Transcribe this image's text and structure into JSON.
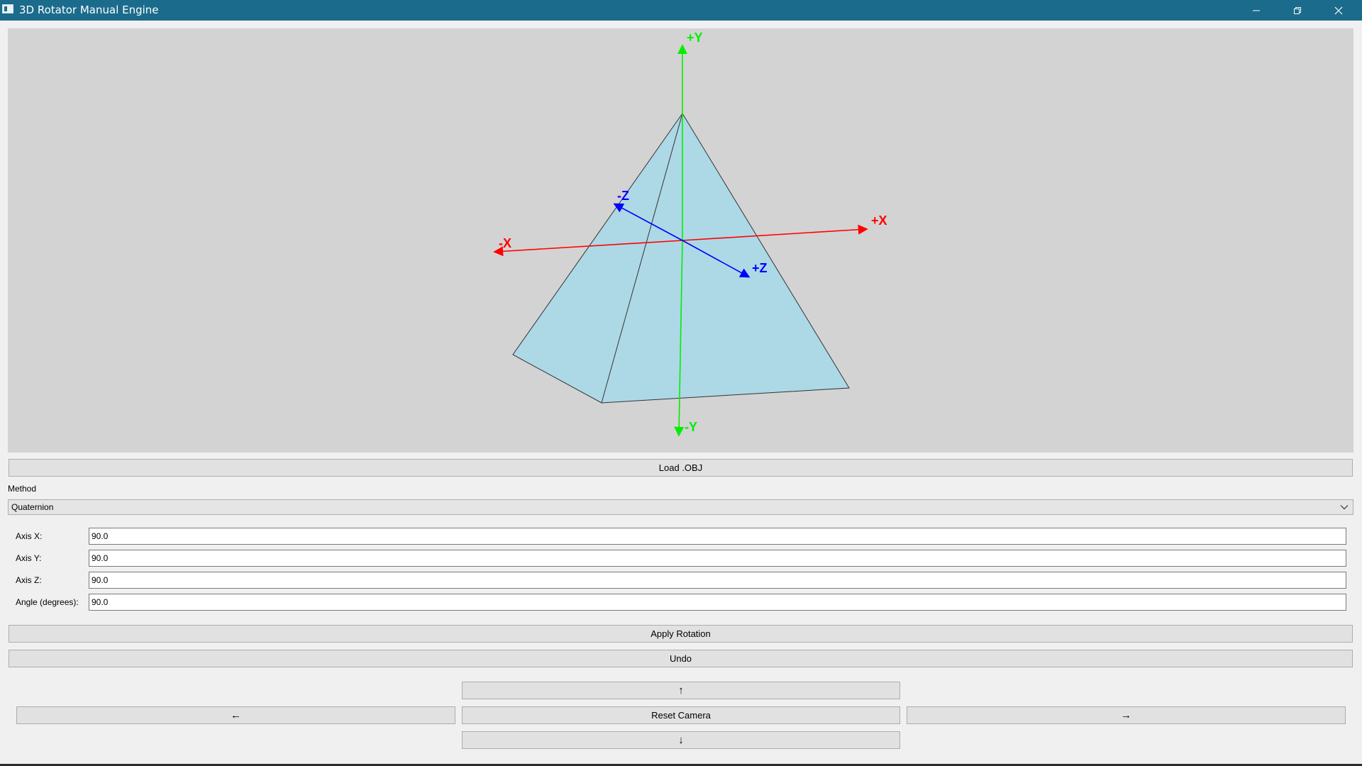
{
  "window": {
    "title": "3D Rotator Manual Engine",
    "controls": {
      "minimize_icon": "minimize-icon",
      "maximize_icon": "restore-icon",
      "close_icon": "close-icon"
    },
    "titlebar_color": "#1b6b8c"
  },
  "viewport": {
    "background": "#d3d3d3",
    "axes": {
      "pos_y": "+Y",
      "neg_y": "-Y",
      "pos_x": "+X",
      "neg_x": "-X",
      "pos_z": "+Z",
      "neg_z": "-Z"
    },
    "colors": {
      "x_axis": "#ff0000",
      "y_axis": "#00ff00",
      "z_axis": "#0000ff",
      "model_fill": "#add8e6"
    }
  },
  "load_button": "Load .OBJ",
  "method": {
    "label": "Method",
    "selected": "Quaternion"
  },
  "fields": {
    "axis_x": {
      "label": "Axis X:",
      "value": "90.0"
    },
    "axis_y": {
      "label": "Axis Y:",
      "value": "90.0"
    },
    "axis_z": {
      "label": "Axis Z:",
      "value": "90.0"
    },
    "angle": {
      "label": "Angle (degrees):",
      "value": "90.0"
    }
  },
  "apply_button": "Apply Rotation",
  "undo_button": "Undo",
  "camera": {
    "up": "↑",
    "left": "←",
    "reset": "Reset Camera",
    "right": "→",
    "down": "↓"
  }
}
